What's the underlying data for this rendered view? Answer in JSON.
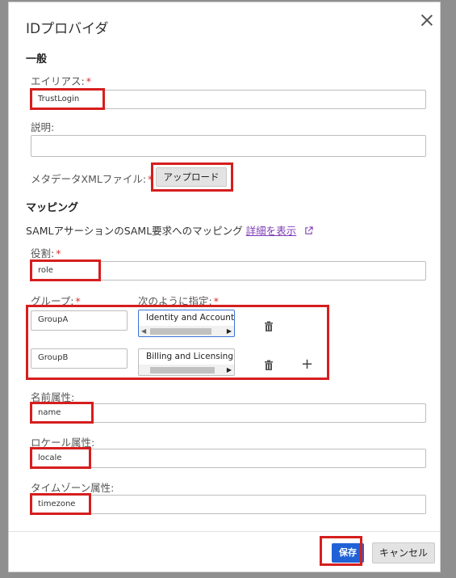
{
  "dialog": {
    "title": "IDプロバイダ",
    "close_label": "×"
  },
  "general": {
    "section_title": "一般",
    "alias_label": "エイリアス:",
    "alias_value": "TrustLogin",
    "description_label": "説明:",
    "description_value": "",
    "metadata_label": "メタデータXMLファイル:",
    "upload_button": "アップロード",
    "required_mark": "*"
  },
  "mapping": {
    "section_title": "マッピング",
    "description": "SAMLアサーションのSAML要求へのマッピング",
    "details_link": "詳細を表示",
    "role_label": "役割:",
    "role_value": "role",
    "group_label": "グループ:",
    "specify_label": "次のように指定:",
    "groups": [
      {
        "group": "GroupA",
        "policy": "Identity and Account"
      },
      {
        "group": "GroupB",
        "policy": "Billing and Licensing"
      }
    ],
    "name_attr_label": "名前属性:",
    "name_attr_value": "name",
    "locale_attr_label": "ロケール属性:",
    "locale_attr_value": "locale",
    "timezone_attr_label": "タイムゾーン属性:",
    "timezone_attr_value": "timezone"
  },
  "footer": {
    "save_button": "保存",
    "cancel_button": "キャンセル"
  },
  "colors": {
    "highlight": "#d61e1e",
    "primary": "#2062d6",
    "link": "#7e3bb5",
    "required": "#d9302c"
  }
}
